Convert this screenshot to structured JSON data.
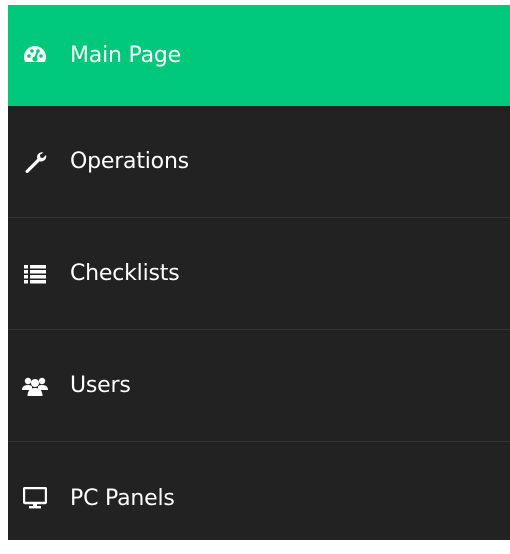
{
  "sidebar": {
    "active_color": "#00c87a",
    "background_color": "#222222",
    "items": [
      {
        "label": "Main Page",
        "icon": "dashboard-icon",
        "active": true
      },
      {
        "label": "Operations",
        "icon": "wrench-icon",
        "active": false
      },
      {
        "label": "Checklists",
        "icon": "list-icon",
        "active": false
      },
      {
        "label": "Users",
        "icon": "users-icon",
        "active": false
      },
      {
        "label": "PC Panels",
        "icon": "monitor-icon",
        "active": false
      }
    ]
  }
}
